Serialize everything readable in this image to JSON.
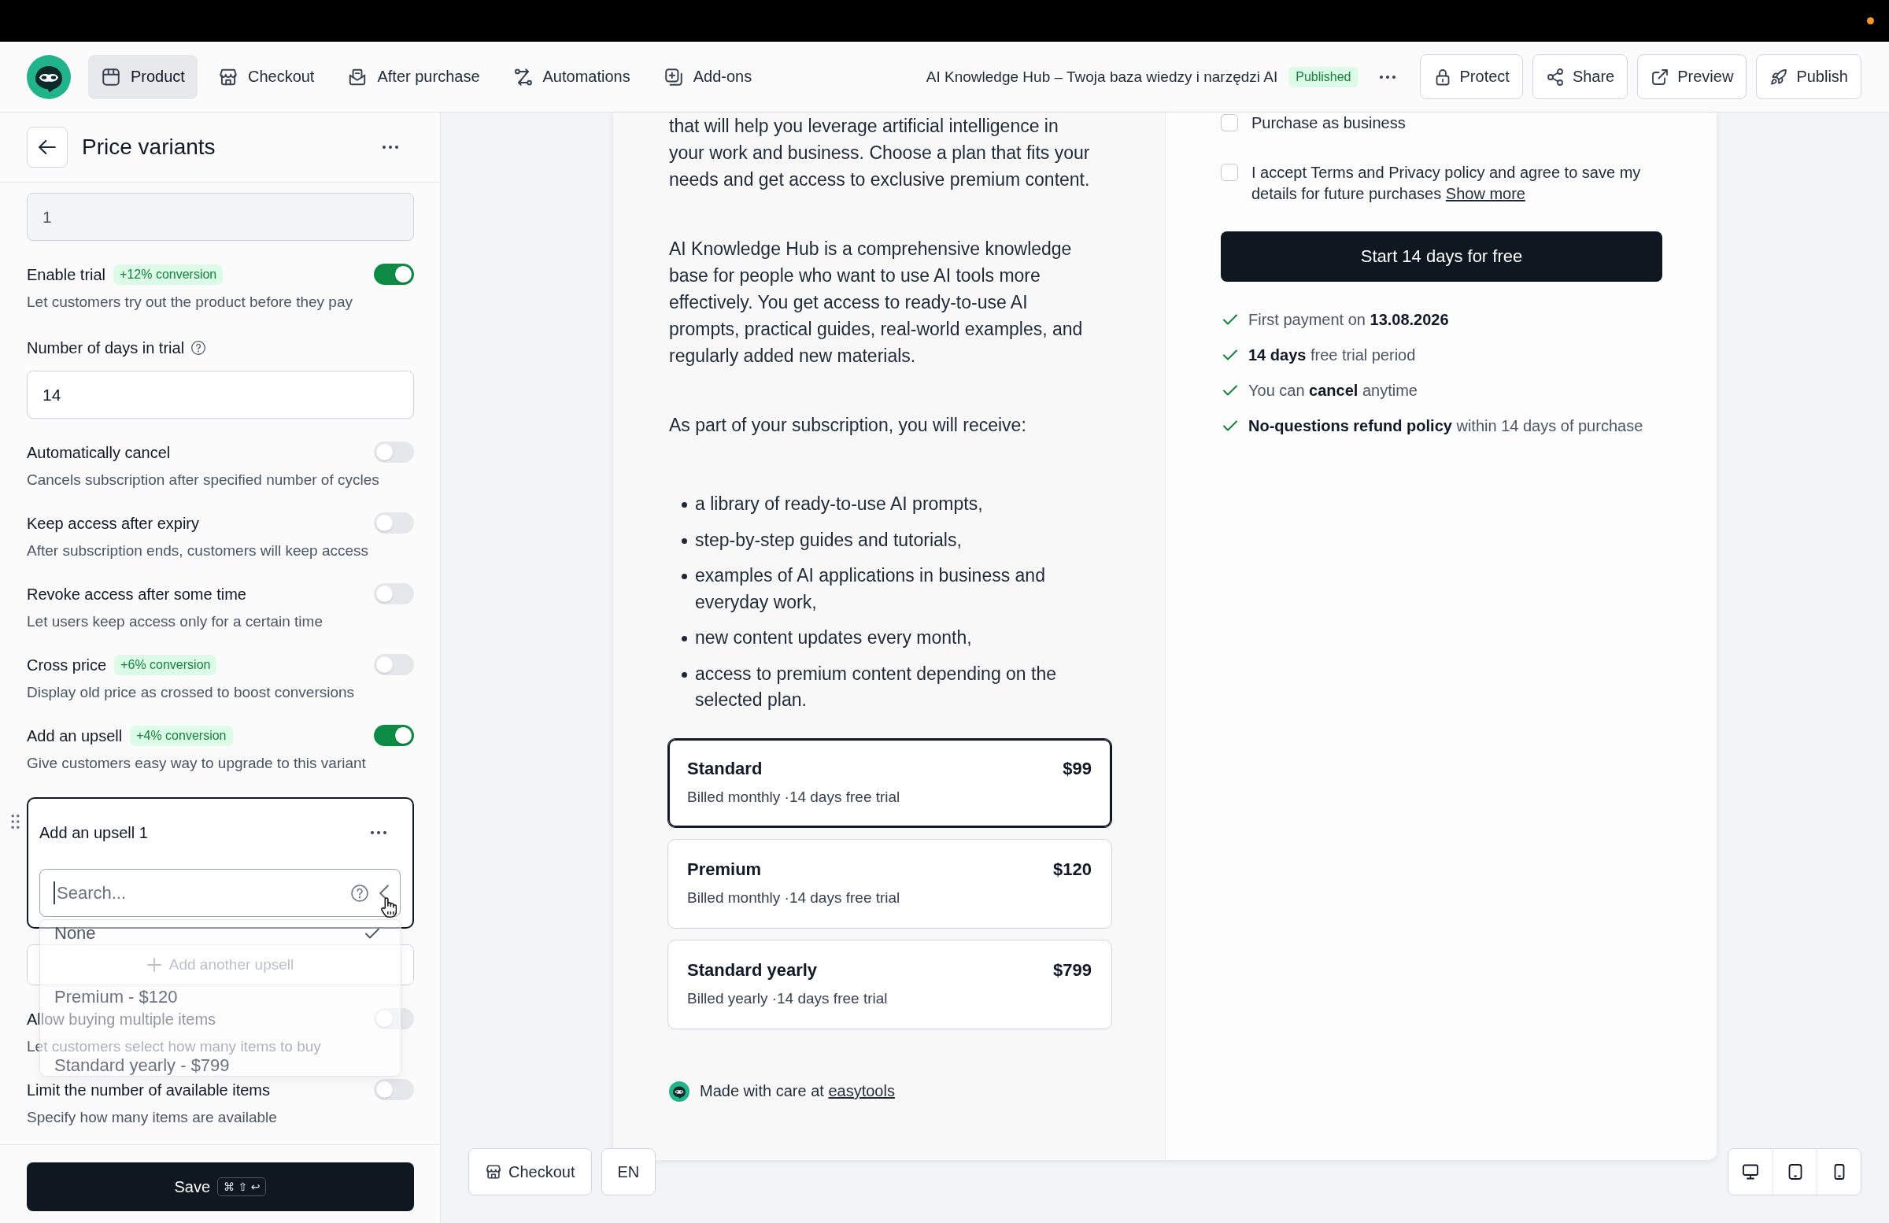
{
  "nav": {
    "tabs": [
      {
        "label": "Product",
        "selected": true
      },
      {
        "label": "Checkout",
        "selected": false
      },
      {
        "label": "After purchase",
        "selected": false
      },
      {
        "label": "Automations",
        "selected": false
      },
      {
        "label": "Add-ons",
        "selected": false
      }
    ],
    "page_title": "AI Knowledge Hub – Twoja baza wiedzy i narzędzi AI",
    "status": "Published",
    "actions": [
      "Protect",
      "Share",
      "Preview",
      "Publish"
    ]
  },
  "panel": {
    "title": "Price variants",
    "settings": [
      {
        "kind": "field",
        "value": "1",
        "disabled": true
      },
      {
        "kind": "toggle",
        "label": "Enable trial",
        "badge": "+12% conversion",
        "description": "Let customers try out the product before they pay",
        "on": true
      },
      {
        "kind": "field",
        "label": "Number of days in trial",
        "value": "14",
        "disabled": false
      },
      {
        "kind": "toggle",
        "label": "Automatically cancel",
        "description": "Cancels subscription after specified number of cycles",
        "on": false
      },
      {
        "kind": "toggle",
        "label": "Keep access after expiry",
        "description": "After subscription ends, customers will keep access",
        "on": false
      },
      {
        "kind": "toggle",
        "label": "Revoke access after some time",
        "description": "Let users keep access only for a certain time",
        "on": false
      },
      {
        "kind": "toggle",
        "label": "Cross price",
        "badge": "+6% conversion",
        "description": "Display old price as crossed to boost conversions",
        "on": false
      },
      {
        "kind": "toggle",
        "label": "Add an upsell",
        "badge": "+4% conversion",
        "description": "Give customers easy way to upgrade to this variant",
        "on": true
      },
      {
        "kind": "upsell",
        "title": "Add an upsell 1",
        "search": {
          "placeholder": "Search..."
        },
        "options": [
          {
            "label": "None",
            "selected": true
          },
          {
            "label": "Premium - $120",
            "selected": false
          },
          {
            "label": "Standard yearly - $799",
            "selected": false
          }
        ]
      },
      {
        "kind": "add_button",
        "label": "Add another upsell"
      },
      {
        "kind": "toggle",
        "label": "Allow buying multiple items",
        "description": "Let customers select how many items to buy",
        "on": false
      },
      {
        "kind": "toggle",
        "label": "Limit the number of available items",
        "description": "Specify how many items are available",
        "on": false
      }
    ],
    "save": {
      "label": "Save",
      "shortcut": "⌘ ⇧ ↩"
    }
  },
  "preview": {
    "paragraphs": [
      "that will help you leverage artificial intelligence in your work and business. Choose a plan that fits your needs and get access to exclusive premium content.",
      "AI Knowledge Hub is a comprehensive knowledge base for people who want to use AI tools more effectively. You get access to ready-to-use AI prompts, practical guides, real-world examples, and regularly added new materials.",
      "As part of your subscription, you will receive:"
    ],
    "bullets": [
      "a library of ready-to-use AI prompts,",
      "step-by-step guides and tutorials,",
      "examples of AI applications in business and everyday work,",
      "new content updates every month,",
      "access to premium content depending on the selected plan."
    ],
    "plans": [
      {
        "name": "Standard",
        "price": "$99",
        "details": "Billed monthly ·14 days free trial",
        "selected": true
      },
      {
        "name": "Premium",
        "price": "$120",
        "details": "Billed monthly ·14 days free trial",
        "selected": false
      },
      {
        "name": "Standard yearly",
        "price": "$799",
        "details": "Billed yearly ·14 days free trial",
        "selected": false
      }
    ],
    "footer": {
      "text": "Made with care at",
      "link": "easytools"
    }
  },
  "checkout": {
    "checkboxes": [
      {
        "label": "Purchase as business",
        "checked": false
      },
      {
        "label": "I accept Terms and Privacy policy and agree to save my details for future purchases",
        "link": "Show more",
        "checked": false
      }
    ],
    "cta": "Start 14 days for free",
    "benefits": [
      "First payment on **13.08.2026**",
      "**14 days** free trial period",
      "You can **cancel** anytime",
      "**No-questions refund policy** within 14 days of purchase"
    ]
  },
  "toolbar": {
    "view": "Checkout",
    "language": "EN"
  }
}
